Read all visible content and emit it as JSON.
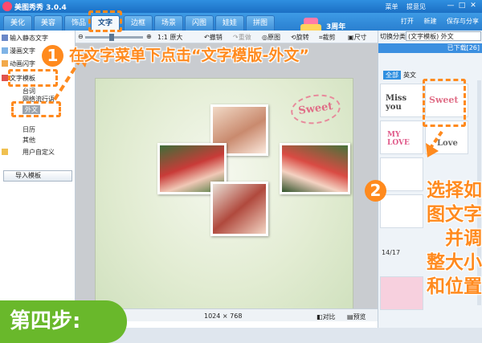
{
  "window": {
    "title": "美图秀秀 3.0.4",
    "links": [
      "菜单",
      "提意见"
    ]
  },
  "tabs": [
    {
      "label": "美化"
    },
    {
      "label": "美容"
    },
    {
      "label": "饰品"
    },
    {
      "label": "文字"
    },
    {
      "label": "边框"
    },
    {
      "label": "场景"
    },
    {
      "label": "闪图"
    },
    {
      "label": "娃娃"
    },
    {
      "label": "拼图"
    }
  ],
  "banner": {
    "text": "3周年"
  },
  "actions": {
    "open": "打开",
    "new": "新建",
    "save_share": "保存与分享"
  },
  "toolbar": {
    "zoom_label": "1:1 原大",
    "undo": "撤销",
    "redo": "重做",
    "original": "原图",
    "rotate": "旋转",
    "crop": "裁剪",
    "resize": "尺寸"
  },
  "left_panel": {
    "items": [
      "输入静态文字",
      "漫画文字",
      "动画闪字",
      "文字模板"
    ],
    "subitems": [
      "台词",
      "网络流行语",
      "外文",
      "日历",
      "其他"
    ],
    "custom": "用户自定义",
    "import": "导入模板"
  },
  "right_panel": {
    "category_label": "切换分类",
    "category_value": "(文字模板) 外文",
    "download_label": "已下载[26]",
    "tabs": [
      "全部",
      "英文"
    ],
    "stickers": [
      "Miss you",
      "Sweet",
      "MY LOVE",
      "Love"
    ],
    "pager": "14/17"
  },
  "status": {
    "size": "1024 × 768",
    "compare": "对比",
    "preview": "预览"
  },
  "canvas": {
    "sticker_text": "Sweet"
  },
  "annotations": {
    "step1": {
      "number": "1",
      "text": "在文字菜单下点击“文字模版-外文”"
    },
    "step2": {
      "number": "2",
      "lines": [
        "选择如",
        "图文字",
        "并调",
        "整大小",
        "和位置"
      ]
    },
    "step_label": "第四步:"
  },
  "colors": {
    "accent": "#ff8a1e",
    "step_green": "#69b82b",
    "brand_blue": "#2f8fe0"
  }
}
